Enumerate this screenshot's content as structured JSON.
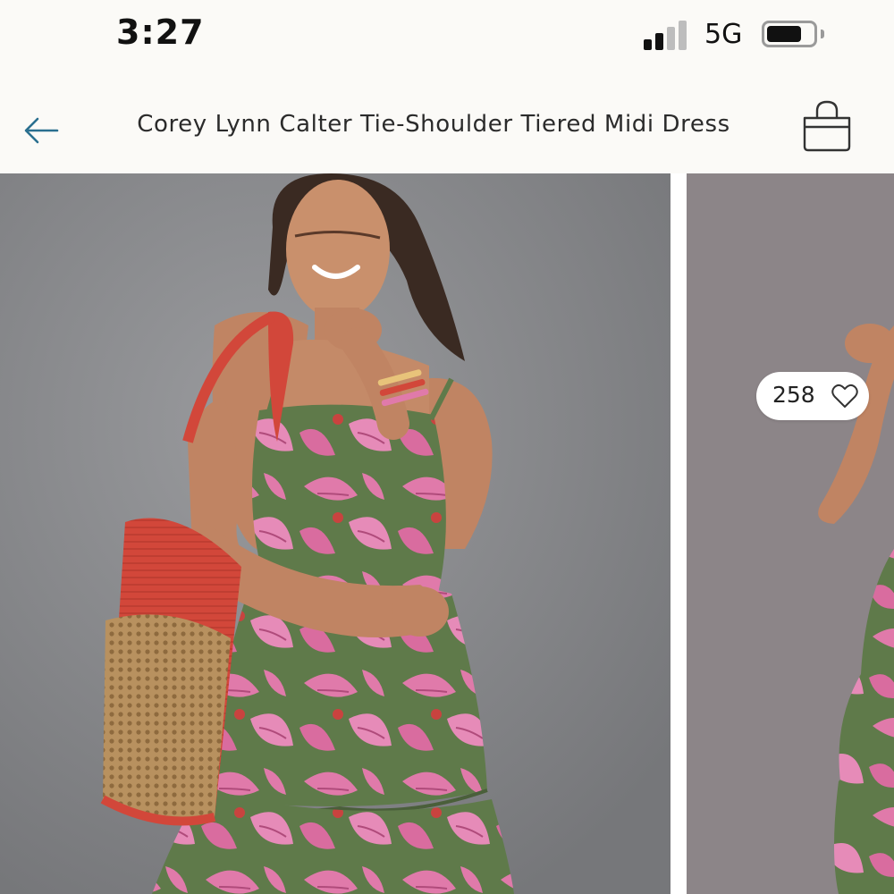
{
  "status_bar": {
    "time": "3:27",
    "network": "5G",
    "signal_bars_active": 2,
    "signal_bars_total": 4,
    "battery_level": 0.75,
    "icons": [
      "signal-icon",
      "battery-icon"
    ]
  },
  "header": {
    "title": "Corey Lynn Calter Tie-Shoulder Tiered Midi Dress",
    "back_icon": "back-arrow-icon",
    "bag_icon": "shopping-bag-icon",
    "accent_color": "#2a6f8f"
  },
  "gallery": {
    "likes_count": "258",
    "like_icon": "heart-outline-icon",
    "photos": [
      "product-photo",
      "product-photo"
    ]
  },
  "colors": {
    "background": "#fbfaf7",
    "dress_pink": "#e07aaa",
    "dress_green": "#5f7a4a",
    "bag_red": "#d2473a",
    "bag_tan": "#b8915f"
  }
}
